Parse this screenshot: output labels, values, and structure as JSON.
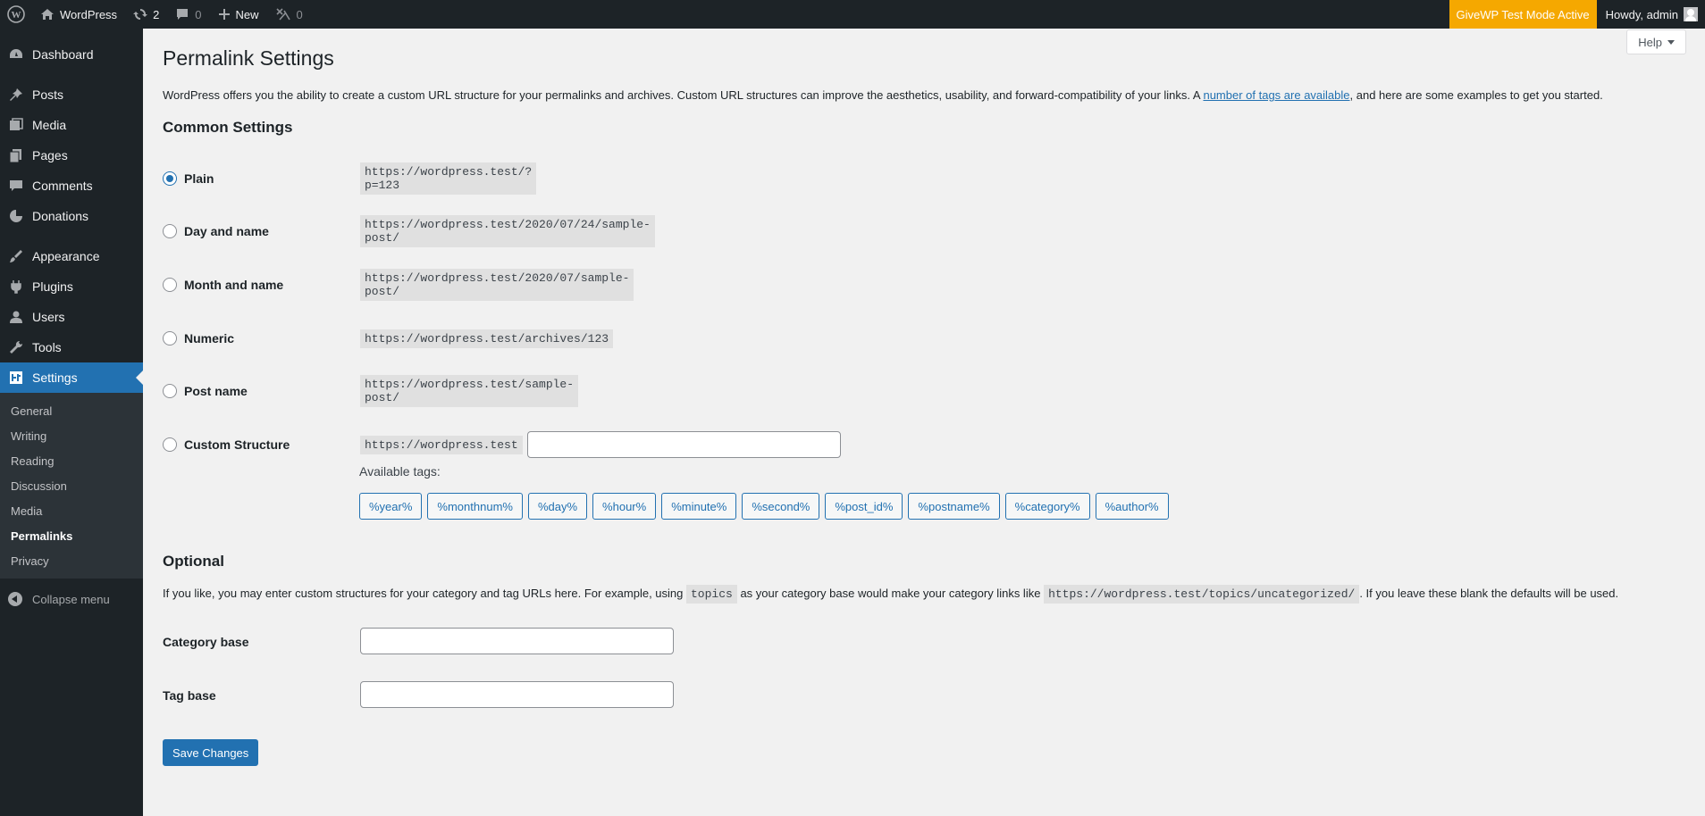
{
  "adminbar": {
    "site_name": "WordPress",
    "updates_count": "2",
    "comments_count": "0",
    "new_label": "New",
    "plugin_count": "0",
    "givewp_badge": "GiveWP Test Mode Active",
    "howdy": "Howdy, admin"
  },
  "sidebar": {
    "items": [
      {
        "label": "Dashboard",
        "icon": "dashboard-icon"
      },
      {
        "label": "Posts",
        "icon": "pin-icon"
      },
      {
        "label": "Media",
        "icon": "media-icon"
      },
      {
        "label": "Pages",
        "icon": "pages-icon"
      },
      {
        "label": "Comments",
        "icon": "comment-icon"
      },
      {
        "label": "Donations",
        "icon": "donations-icon"
      },
      {
        "label": "Appearance",
        "icon": "brush-icon"
      },
      {
        "label": "Plugins",
        "icon": "plug-icon"
      },
      {
        "label": "Users",
        "icon": "user-icon"
      },
      {
        "label": "Tools",
        "icon": "wrench-icon"
      },
      {
        "label": "Settings",
        "icon": "settings-icon"
      }
    ],
    "submenu": [
      "General",
      "Writing",
      "Reading",
      "Discussion",
      "Media",
      "Permalinks",
      "Privacy"
    ],
    "collapse_label": "Collapse menu"
  },
  "page": {
    "help_label": "Help",
    "title": "Permalink Settings",
    "intro_before": "WordPress offers you the ability to create a custom URL structure for your permalinks and archives. Custom URL structures can improve the aesthetics, usability, and forward-compatibility of your links. A ",
    "intro_link": "number of tags are available",
    "intro_after": ", and here are some examples to get you started.",
    "common_heading": "Common Settings",
    "options": [
      {
        "label": "Plain",
        "example": "https://wordpress.test/?p=123",
        "checked": true
      },
      {
        "label": "Day and name",
        "example": "https://wordpress.test/2020/07/24/sample-post/",
        "checked": false
      },
      {
        "label": "Month and name",
        "example": "https://wordpress.test/2020/07/sample-post/",
        "checked": false
      },
      {
        "label": "Numeric",
        "example": "https://wordpress.test/archives/123",
        "checked": false
      },
      {
        "label": "Post name",
        "example": "https://wordpress.test/sample-post/",
        "checked": false
      },
      {
        "label": "Custom Structure",
        "example": "https://wordpress.test",
        "checked": false
      }
    ],
    "custom_structure_value": "",
    "available_tags_label": "Available tags:",
    "tags": [
      "%year%",
      "%monthnum%",
      "%day%",
      "%hour%",
      "%minute%",
      "%second%",
      "%post_id%",
      "%postname%",
      "%category%",
      "%author%"
    ],
    "optional_heading": "Optional",
    "optional_text_1": "If you like, you may enter custom structures for your category and tag URLs here. For example, using",
    "optional_code_1": "topics",
    "optional_text_2": "as your category base would make your category links like",
    "optional_code_2": "https://wordpress.test/topics/uncategorized/",
    "optional_text_3": ". If you leave these blank the defaults will be used.",
    "category_base_label": "Category base",
    "category_base_value": "",
    "tag_base_label": "Tag base",
    "tag_base_value": "",
    "save_label": "Save Changes"
  },
  "colors": {
    "admin_bg": "#1d2327",
    "accent": "#2271b1",
    "givewp_badge": "#f5a800",
    "page_bg": "#f1f1f1"
  }
}
